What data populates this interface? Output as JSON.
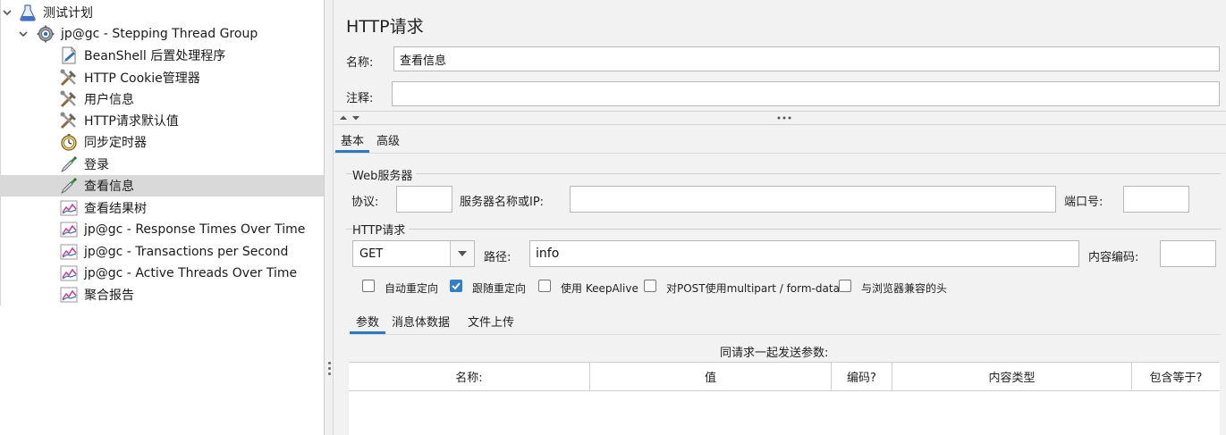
{
  "tree": {
    "items": [
      {
        "label": "测试计划",
        "icon": "test-plan-flask-icon"
      },
      {
        "label": "jp@gc - Stepping Thread Group",
        "icon": "thread-group-gear-icon"
      },
      {
        "label": "BeanShell 后置处理程序",
        "icon": "beanshell-script-icon"
      },
      {
        "label": "HTTP Cookie管理器",
        "icon": "config-tools-icon"
      },
      {
        "label": "用户信息",
        "icon": "config-tools-icon"
      },
      {
        "label": "HTTP请求默认值",
        "icon": "config-tools-icon"
      },
      {
        "label": "同步定时器",
        "icon": "timer-stopwatch-icon"
      },
      {
        "label": "登录",
        "icon": "sampler-pipette-icon"
      },
      {
        "label": "查看信息",
        "icon": "sampler-pipette-icon"
      },
      {
        "label": "查看结果树",
        "icon": "listener-graph-icon"
      },
      {
        "label": "jp@gc - Response Times Over Time",
        "icon": "listener-graph-icon"
      },
      {
        "label": "jp@gc - Transactions per Second",
        "icon": "listener-graph-icon"
      },
      {
        "label": "jp@gc - Active Threads Over Time",
        "icon": "listener-graph-icon"
      },
      {
        "label": "聚合报告",
        "icon": "listener-graph-icon"
      }
    ]
  },
  "panel": {
    "title": "HTTP请求",
    "name_label": "名称:",
    "name_value": "查看信息",
    "comment_label": "注释:",
    "comment_value": ""
  },
  "tabs": {
    "basic": "基本",
    "advanced": "高级"
  },
  "web_server": {
    "group_title": "Web服务器",
    "protocol_label": "协议:",
    "protocol_value": "",
    "server_label": "服务器名称或IP:",
    "server_value": "",
    "port_label": "端口号:",
    "port_value": ""
  },
  "http_request": {
    "group_title": "HTTP请求",
    "method": "GET",
    "path_label": "路径:",
    "path_value": "info",
    "encoding_label": "内容编码:",
    "encoding_value": ""
  },
  "options": [
    {
      "label": "自动重定向",
      "checked": false
    },
    {
      "label": "跟随重定向",
      "checked": true
    },
    {
      "label": "使用 KeepAlive",
      "checked": false
    },
    {
      "label": "对POST使用multipart / form-data",
      "checked": false
    },
    {
      "label": "与浏览器兼容的头",
      "checked": false
    }
  ],
  "sub_tabs": {
    "params": "参数",
    "body": "消息体数据",
    "files": "文件上传"
  },
  "params": {
    "caption": "同请求一起发送参数:",
    "columns": [
      "名称:",
      "值",
      "编码?",
      "内容类型",
      "包含等于?"
    ]
  },
  "colors": {
    "accent": "#2a7ac4",
    "selected_row": "#d9d9d9",
    "panel_bg": "#f2f2f2"
  }
}
